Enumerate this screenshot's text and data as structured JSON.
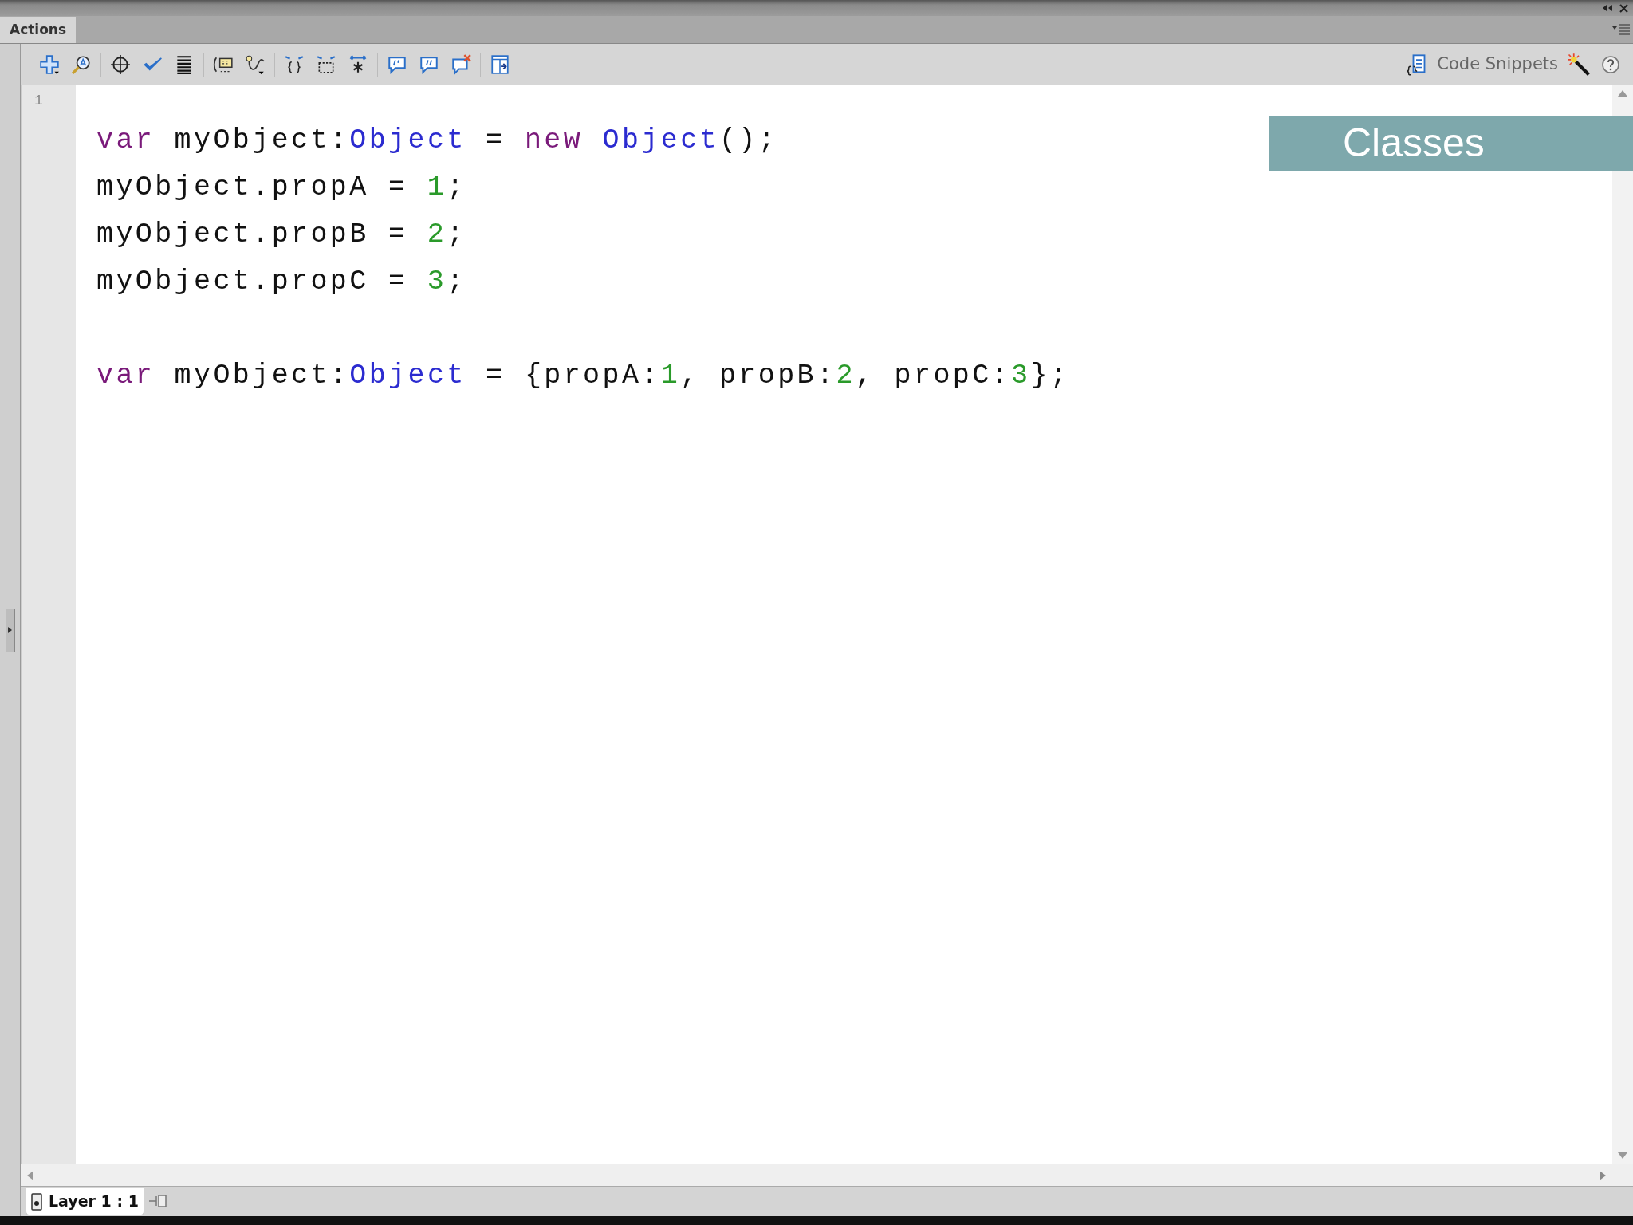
{
  "panel": {
    "title": "Actions",
    "selected": true
  },
  "toolbar": {
    "code_snippets": "Code Snippets"
  },
  "editor": {
    "line_numbers": [
      "1"
    ],
    "code_blocks": [
      {
        "lines": [
          [
            {
              "text": "var",
              "kind": "keyword"
            },
            {
              "text": " myObject:",
              "kind": "plain"
            },
            {
              "text": "Object",
              "kind": "type"
            },
            {
              "text": " = ",
              "kind": "plain"
            },
            {
              "text": "new",
              "kind": "keyword"
            },
            {
              "text": " Object",
              "kind": "type"
            },
            {
              "text": "();",
              "kind": "plain"
            }
          ],
          [
            {
              "text": "myObject.propA = ",
              "kind": "plain"
            },
            {
              "text": "1",
              "kind": "number"
            },
            {
              "text": ";",
              "kind": "plain"
            }
          ],
          [
            {
              "text": "myObject.propB = ",
              "kind": "plain"
            },
            {
              "text": "2",
              "kind": "number"
            },
            {
              "text": ";",
              "kind": "plain"
            }
          ],
          [
            {
              "text": "myObject.propC = ",
              "kind": "plain"
            },
            {
              "text": "3",
              "kind": "number"
            },
            {
              "text": ";",
              "kind": "plain"
            }
          ]
        ]
      },
      {
        "lines": [
          [
            {
              "text": "var",
              "kind": "keyword"
            },
            {
              "text": " myObject:",
              "kind": "plain"
            },
            {
              "text": "Object",
              "kind": "type"
            },
            {
              "text": " = {propA:",
              "kind": "plain"
            },
            {
              "text": "1",
              "kind": "number"
            },
            {
              "text": ", propB:",
              "kind": "plain"
            },
            {
              "text": "2",
              "kind": "number"
            },
            {
              "text": ", propC:",
              "kind": "plain"
            },
            {
              "text": "3",
              "kind": "number"
            },
            {
              "text": "};",
              "kind": "plain"
            }
          ]
        ]
      }
    ]
  },
  "overlay": {
    "title": "Classes"
  },
  "status_bar": {
    "tab": "Layer 1 : 1"
  }
}
